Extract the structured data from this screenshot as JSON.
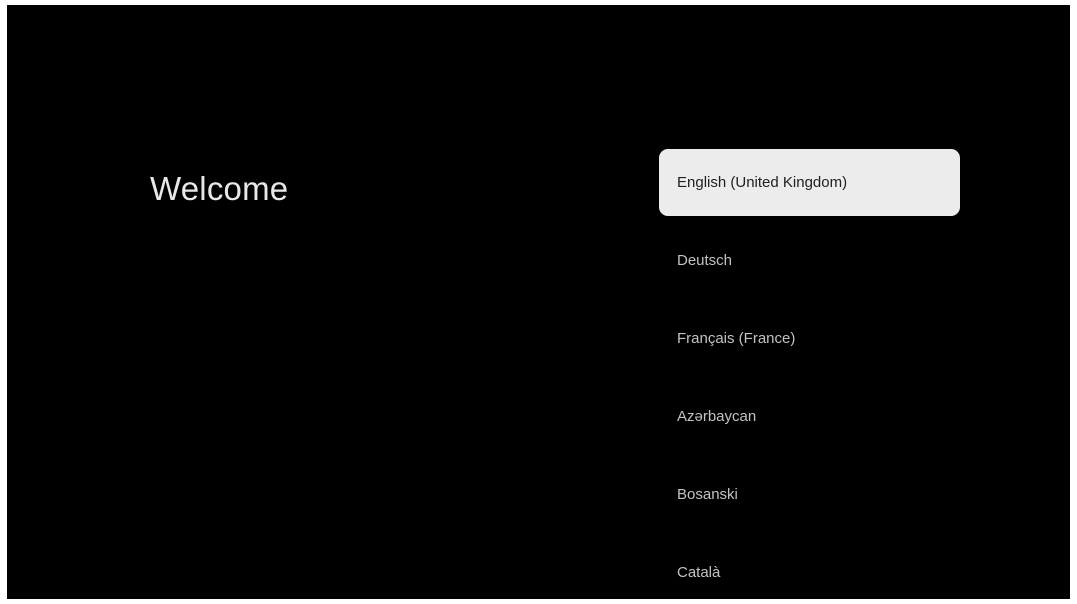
{
  "welcome": {
    "title": "Welcome"
  },
  "languages": {
    "items": [
      {
        "label": "English (United Kingdom)",
        "focused": true
      },
      {
        "label": "Deutsch",
        "focused": false
      },
      {
        "label": "Français (France)",
        "focused": false
      },
      {
        "label": "Azərbaycan",
        "focused": false
      },
      {
        "label": "Bosanski",
        "focused": false
      },
      {
        "label": "Català",
        "focused": false
      }
    ]
  },
  "colors": {
    "background": "#000000",
    "focused_item_bg": "#ececec",
    "focused_item_text": "#202020",
    "item_text": "#c2c2c2",
    "title_text": "#e8e8e8"
  }
}
